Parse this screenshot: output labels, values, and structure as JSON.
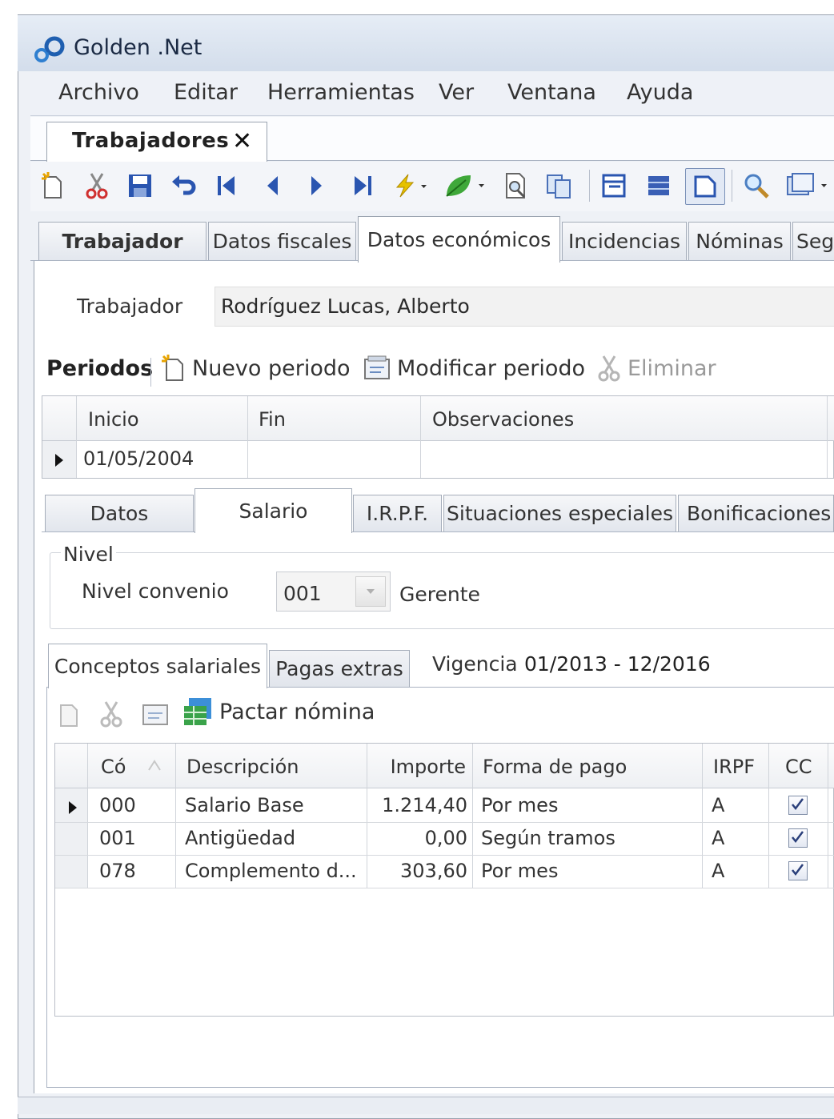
{
  "app": {
    "title": "Golden .Net"
  },
  "menu": [
    "Archivo",
    "Editar",
    "Herramientas",
    "Ver",
    "Ventana",
    "Ayuda"
  ],
  "doc_tab": {
    "label": "Trabajadores",
    "close": "✕"
  },
  "top_tabs": [
    "Trabajador",
    "Datos fiscales",
    "Datos económicos",
    "Incidencias",
    "Nóminas",
    "Seg"
  ],
  "worker": {
    "label": "Trabajador",
    "value": "Rodríguez Lucas, Alberto"
  },
  "periods": {
    "title": "Periodos",
    "new": "Nuevo periodo",
    "modify": "Modificar periodo",
    "delete": "Eliminar",
    "columns": [
      "Inicio",
      "Fin",
      "Observaciones"
    ],
    "rows": [
      {
        "inicio": "01/05/2004",
        "fin": "",
        "observaciones": ""
      }
    ]
  },
  "sub_tabs": [
    "Datos",
    "Salario",
    "I.R.P.F.",
    "Situaciones especiales",
    "Bonificaciones"
  ],
  "nivel": {
    "group": "Nivel",
    "label": "Nivel convenio",
    "code": "001",
    "desc": "Gerente"
  },
  "concept_tabs": [
    "Conceptos salariales",
    "Pagas extras"
  ],
  "vigencia": {
    "label": "Vigencia",
    "value": "01/2013 - 12/2016"
  },
  "concept_toolbar": {
    "pactar": "Pactar nómina"
  },
  "concepts": {
    "columns": [
      "Có",
      "Descripción",
      "Importe",
      "Forma de pago",
      "IRPF",
      "CC"
    ],
    "rows": [
      {
        "code": "000",
        "desc": "Salario Base",
        "importe": "1.214,40",
        "forma": "Por mes",
        "irpf": "A",
        "cc": true
      },
      {
        "code": "001",
        "desc": "Antigüedad",
        "importe": "0,00",
        "forma": "Según tramos",
        "irpf": "A",
        "cc": true
      },
      {
        "code": "078",
        "desc": "Complemento d...",
        "importe": "303,60",
        "forma": "Por mes",
        "irpf": "A",
        "cc": true
      }
    ]
  }
}
